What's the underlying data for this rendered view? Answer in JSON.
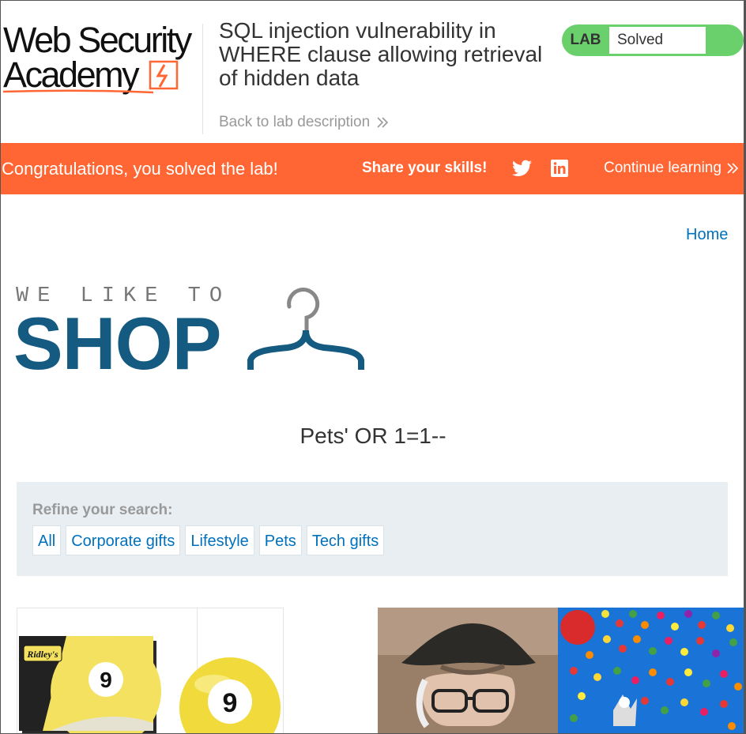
{
  "header": {
    "logo_line1": "Web Security",
    "logo_line2": "Academy",
    "lab_title": "SQL injection vulnerability in WHERE clause allowing retrieval of hidden data",
    "back_link": "Back to lab description",
    "badge_label": "LAB",
    "badge_status": "Solved"
  },
  "banner": {
    "congrats": "Congratulations, you solved the lab!",
    "share_label": "Share your skills!",
    "continue_label": "Continue learning"
  },
  "nav": {
    "home": "Home"
  },
  "shop_logo": {
    "tagline": "WE LIKE TO",
    "word": "SHOP"
  },
  "search": {
    "heading": "Pets' OR 1=1--",
    "refine_label": "Refine your search:",
    "filters": [
      "All",
      "Corporate gifts",
      "Lifestyle",
      "Pets",
      "Tech gifts"
    ]
  },
  "products": [
    {
      "label": "Ridley's",
      "number": "9"
    },
    {
      "number": "9"
    }
  ],
  "colors": {
    "accent_orange": "#ff6633",
    "badge_green": "#6ad06b",
    "link_blue": "#0071bc",
    "shop_blue": "#155a81",
    "refine_bg": "#e8eef1"
  },
  "icons": [
    "bolt-icon",
    "chevron-right-icon",
    "twitter-icon",
    "linkedin-icon",
    "hanger-icon"
  ]
}
